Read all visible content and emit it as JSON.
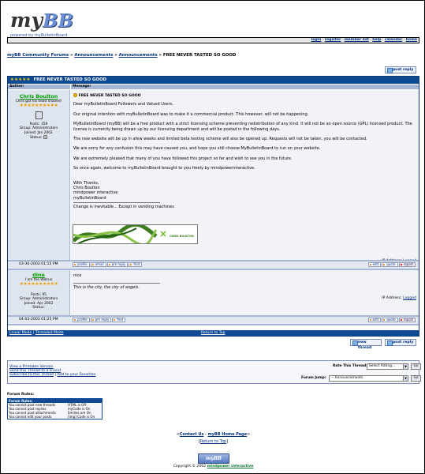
{
  "header": {
    "logo_main": "my",
    "logo_accent": "BB",
    "logo_sub": "powered by myBulletinBoard",
    "nav": [
      "login",
      "register",
      "member list",
      "help",
      "calendar",
      "home"
    ]
  },
  "breadcrumb": {
    "forum": "myBB Community Forums",
    "sep": " » ",
    "cat": "Announcements",
    "sub": "Announcements",
    "current": "FREE NEVER TASTED SO GOOD"
  },
  "buttons": {
    "post_reply": "post reply",
    "new_thread": "new thread"
  },
  "thread": {
    "rating_stars": "★★★★★",
    "title": "FREE NEVER TASTED SO GOOD",
    "col_author": "Author:",
    "col_message": "Message:"
  },
  "posts": [
    {
      "author": "Chris Boulton",
      "user_title": "Chris got his head shaved!",
      "stars": "★★★★★★★★★★",
      "posts": "Posts: 359",
      "group": "Group: Administrators",
      "joined": "Joined: Jan 2002",
      "status": "Status:",
      "subject": "FREE NEVER TASTED SO GOOD",
      "body": [
        "Dear myBulletinBoard Followers and Valued Users,",
        "Our original intention with myBulletinBoard was to make it a commercial product. This however, will not be happening.",
        "MyBulletinBoard (myBB) will be a free product with a strict licensing scheme preventing redistribution of any kind. It will not be an open source (GPL) licensed product. The license is currently being drawn up by our licensing department and will be posted in the following days.",
        "The new website will be up in afew weeks and limited beta testing scheme will also be opened up. Requests will not be taken, you will be contacted.",
        "We are sorry for any confusion this may have caused you, and hope you still choose MyBulletinBoard to run on your website.",
        "We are extremely pleased that many of you have followed this project so far and wish to see you in the future.",
        "So once again, welcome to myBulletinBoard brought to you freely by mindpowerinteractive."
      ],
      "signoff": [
        "With Thanks,",
        "Chris Boulton",
        "mindpower interactive",
        "myBulletinBoard"
      ],
      "signature": "Change is inevitable... Except in vending machines",
      "sig_banner_text": "CHRIS BOULTON",
      "ip_label": "IP Address:",
      "ip_value": "Logged",
      "date": "03-30-2003 01:15 PM"
    },
    {
      "author": "dine",
      "user_title": "I am the Walrus",
      "stars": "★★★★★★★★★★",
      "posts": "Posts: 95",
      "group": "Group: Administrators",
      "joined": "Joined: Apr 2002",
      "status": "Status:",
      "body_line": "nice",
      "signature": "This is the city, the city of angels.",
      "ip_label": "IP Address:",
      "ip_value": "Logged",
      "date": "04-03-2003 01:25 PM"
    }
  ],
  "post_buttons": {
    "profile": "profile",
    "email": "email",
    "pm": "pm reply",
    "find": "find",
    "edit": "edit",
    "quote": "quote",
    "report": "report"
  },
  "modes": {
    "linear": "Linear Mode",
    "sep": " | ",
    "threaded": "Threaded Mode",
    "top": "Return to Top"
  },
  "options": {
    "printable": "View a Printable Version",
    "friend": "Send this Thread to a Friend",
    "subscribe": "Subscribe to this Thread",
    "favorites": "Add to your Favorites",
    "rate_label": "Rate This Thread:",
    "rate_value": "Select Rating...",
    "jump_label": "Forum Jump:",
    "jump_value": "-- Announcements",
    "go": "Go"
  },
  "rules": {
    "title": "Forum Rules:",
    "header": "Forum Rules:",
    "left": [
      "You cannot post new threads",
      "You cannot post replies",
      "You cannot post attachments",
      "You cannot edit your posts"
    ],
    "right": [
      "HTML is Off",
      "myCode is On",
      "Smilies are On",
      "[img] Code is On"
    ]
  },
  "footer": {
    "contact": "Contact Us",
    "home": "myBB Home Page",
    "top": "Return to Top",
    "powered": "myBB",
    "copyright": "Copyright © 2002",
    "company": "mindpower interactive"
  }
}
